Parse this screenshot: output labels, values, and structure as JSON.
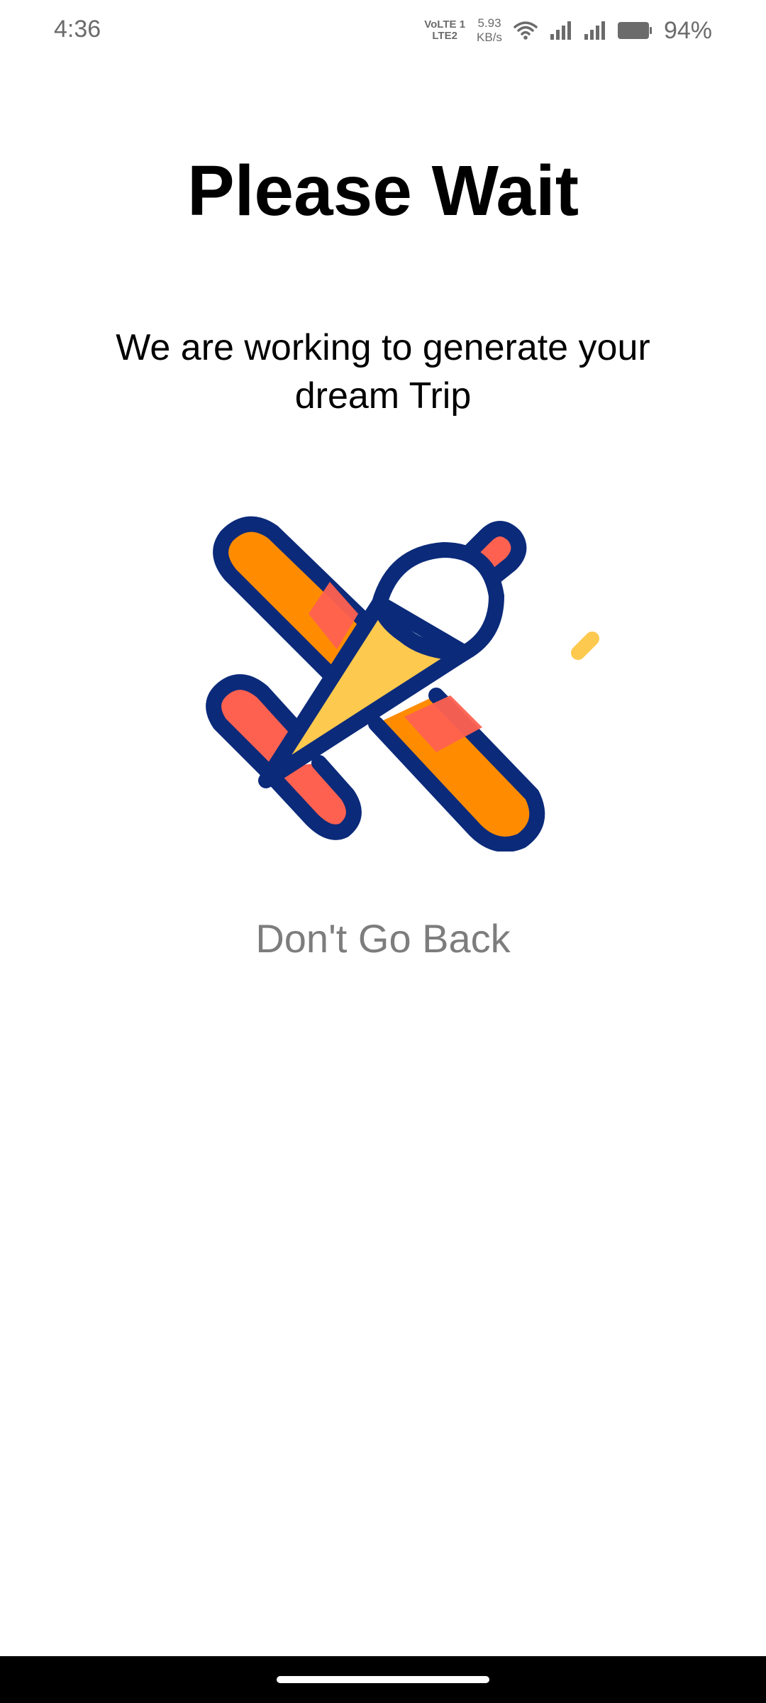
{
  "status_bar": {
    "time": "4:36",
    "volte_line1": "VoLTE 1",
    "volte_line2": "LTE2",
    "speed_value": "5.93",
    "speed_unit": "KB/s",
    "battery": "94%",
    "icons": [
      "volte-icon",
      "wifi-icon",
      "signal-icon",
      "signal-icon",
      "battery-icon"
    ]
  },
  "main": {
    "title": "Please Wait",
    "subtitle": "We are working to generate your dream Trip",
    "note": "Don't Go Back",
    "illustration": "airplane-icon"
  },
  "colors": {
    "background": "#ffffff",
    "title": "#000000",
    "note": "#7d7d7d",
    "plane_outline": "#0b2a7a",
    "plane_orange": "#ff8c00",
    "plane_coral": "#ff6150",
    "plane_yellow": "#fdc94f"
  }
}
